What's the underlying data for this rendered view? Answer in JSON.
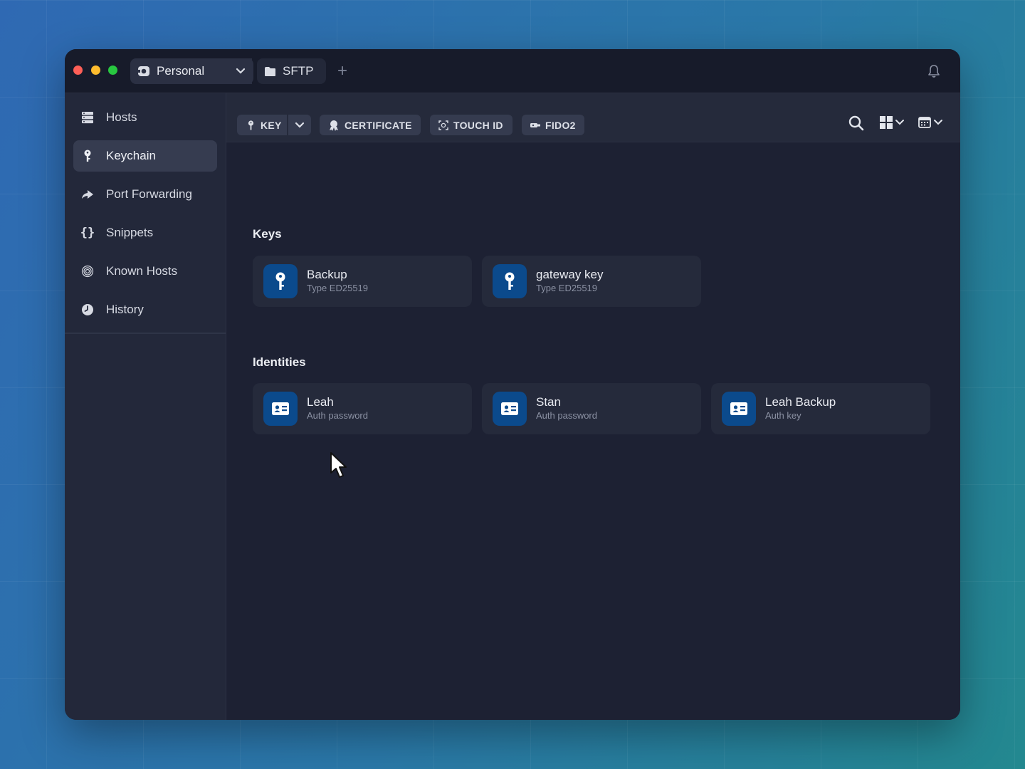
{
  "titlebar": {
    "vault_tab": "Personal",
    "sftp_tab": "SFTP",
    "new_tab_symbol": "+"
  },
  "sidebar": {
    "items": [
      {
        "label": "Hosts",
        "icon": "hosts-icon"
      },
      {
        "label": "Keychain",
        "icon": "key-icon",
        "active": true
      },
      {
        "label": "Port Forwarding",
        "icon": "port-forwarding-icon"
      },
      {
        "label": "Snippets",
        "icon": "braces-icon"
      },
      {
        "label": "Known Hosts",
        "icon": "fingerprint-icon"
      },
      {
        "label": "History",
        "icon": "clock-icon"
      }
    ]
  },
  "toolbar": {
    "key": "KEY",
    "certificate": "CERTIFICATE",
    "touch_id": "TOUCH ID",
    "fido2": "FIDO2"
  },
  "keys": {
    "title": "Keys",
    "items": [
      {
        "name": "Backup",
        "detail": "Type ED25519"
      },
      {
        "name": "gateway key",
        "detail": "Type ED25519"
      }
    ]
  },
  "identities": {
    "title": "Identities",
    "items": [
      {
        "name": "Leah",
        "detail": "Auth password"
      },
      {
        "name": "Stan",
        "detail": "Auth password"
      },
      {
        "name": "Leah Backup",
        "detail": "Auth key"
      }
    ]
  },
  "colors": {
    "accent_icon_bg": "#0b4a8c",
    "window_bg": "#1d2133",
    "sidebar_bg": "#23283a"
  }
}
